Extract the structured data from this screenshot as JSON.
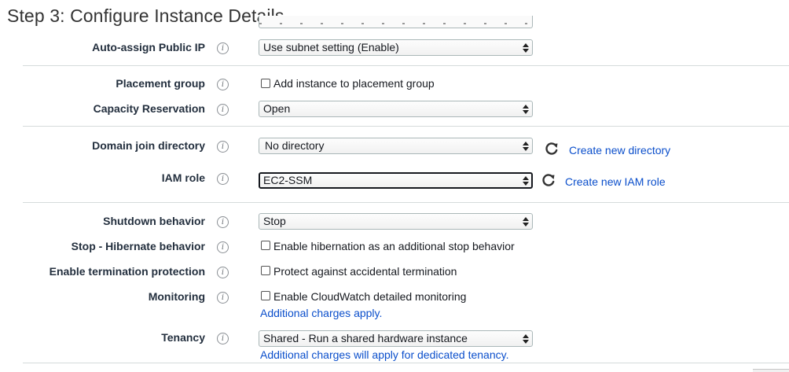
{
  "page": {
    "title": "Step 3: Configure Instance Details"
  },
  "rows": {
    "public_ip": {
      "label": "Auto-assign Public IP",
      "value": "Use subnet setting (Enable)"
    },
    "placement_group": {
      "label": "Placement group",
      "checkbox_label": "Add instance to placement group"
    },
    "capacity_reservation": {
      "label": "Capacity Reservation",
      "value": "Open"
    },
    "domain_join": {
      "label": "Domain join directory",
      "value": "No directory",
      "link": "Create new directory"
    },
    "iam_role": {
      "label": "IAM role",
      "value": "EC2-SSM",
      "link": "Create new IAM role"
    },
    "shutdown": {
      "label": "Shutdown behavior",
      "value": "Stop"
    },
    "hibernate": {
      "label": "Stop - Hibernate behavior",
      "checkbox_label": "Enable hibernation as an additional stop behavior"
    },
    "termination": {
      "label": "Enable termination protection",
      "checkbox_label": "Protect against accidental termination"
    },
    "monitoring": {
      "label": "Monitoring",
      "checkbox_label": "Enable CloudWatch detailed monitoring",
      "note": "Additional charges apply."
    },
    "tenancy": {
      "label": "Tenancy",
      "value": "Shared - Run a shared hardware instance",
      "note": "Additional charges will apply for dedicated tenancy."
    }
  },
  "icons": {
    "info": "i",
    "refresh": "refresh-icon"
  },
  "colors": {
    "link": "#0a4ecb",
    "label": "#232f3e",
    "border": "#aab7b8"
  }
}
